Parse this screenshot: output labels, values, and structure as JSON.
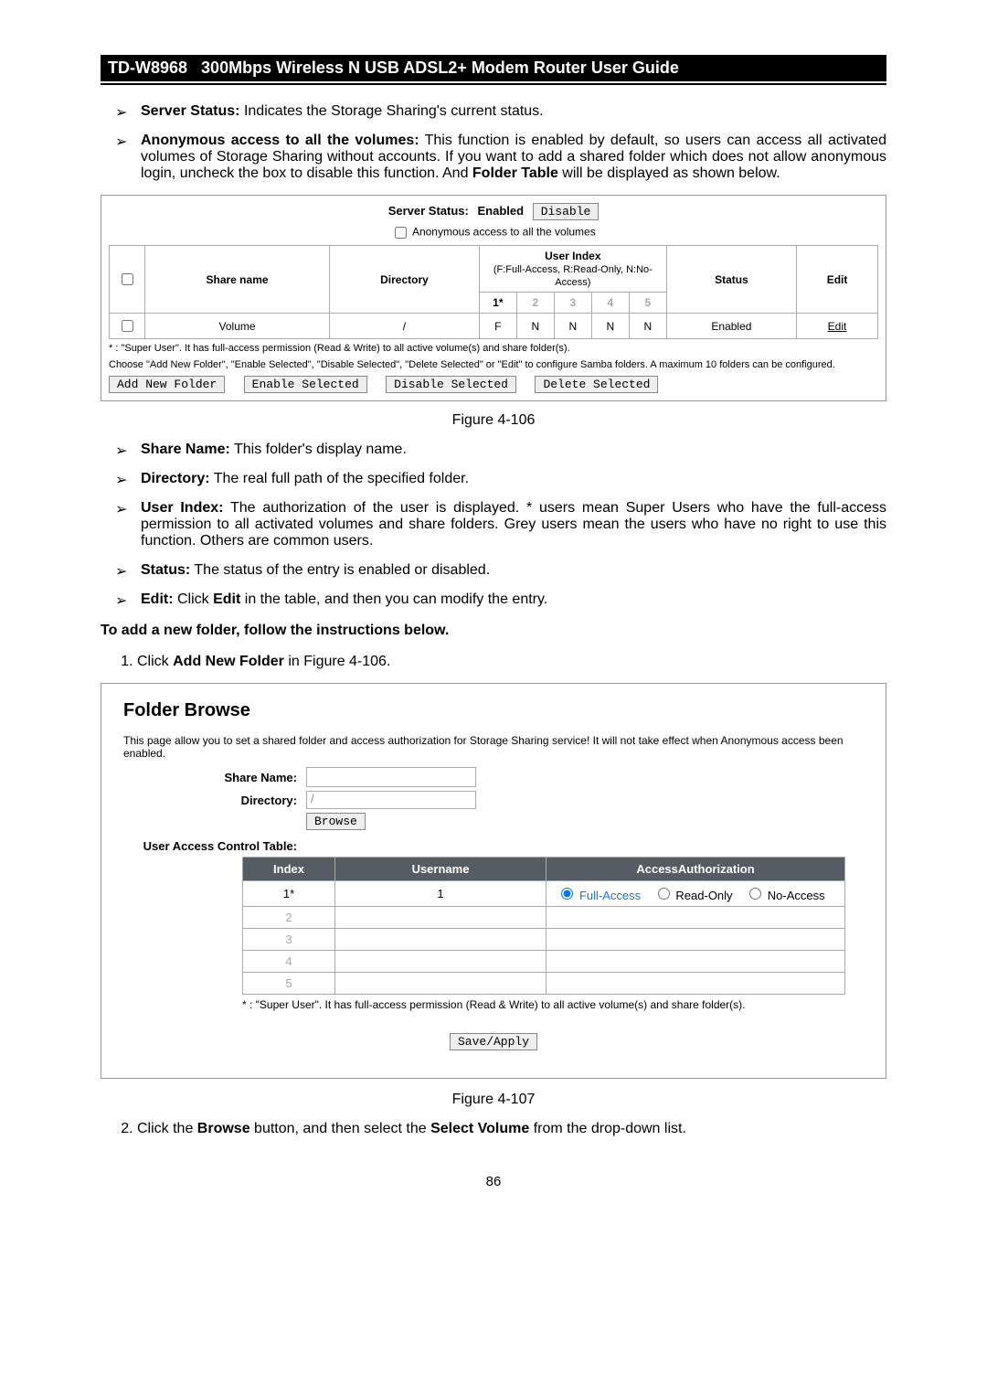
{
  "header": {
    "model": "TD-W8968",
    "title": "300Mbps Wireless N USB ADSL2+ Modem Router User Guide"
  },
  "intro_bullets": {
    "b1_label": "Server Status:",
    "b1_text": " Indicates the Storage Sharing's current status.",
    "b2_label": "Anonymous access to all the volumes:",
    "b2_text": " This function is enabled by default, so users can access all activated volumes of Storage Sharing without accounts. If you want to add a shared folder which does not allow anonymous login, uncheck the box to disable this function. And ",
    "b2_bold2": "Folder Table",
    "b2_tail": " will be displayed as shown below."
  },
  "fig106": {
    "server_status_label": "Server Status:",
    "enabled": "Enabled",
    "disable_btn": "Disable",
    "anon_label": "Anonymous access to all the volumes",
    "th_share": "Share name",
    "th_dir": "Directory",
    "th_userindex": "User Index",
    "th_userindex_sub": "(F:Full-Access, R:Read-Only, N:No-Access)",
    "th_status": "Status",
    "th_edit": "Edit",
    "row": {
      "share": "Volume",
      "dir": "/",
      "u1": "F",
      "u2": "N",
      "u3": "N",
      "u4": "N",
      "u5": "N",
      "status": "Enabled",
      "edit": "Edit"
    },
    "idx1": "1*",
    "idx2": "2",
    "idx3": "3",
    "idx4": "4",
    "idx5": "5",
    "note1": "* : \"Super User\". It has full-access permission (Read & Write) to all active volume(s) and share folder(s).",
    "note2": "Choose \"Add New Folder\", \"Enable Selected\", \"Disable Selected\", \"Delete Selected\" or \"Edit\" to configure Samba folders. A maximum 10 folders can be configured.",
    "btn_add": "Add New Folder",
    "btn_en": "Enable Selected",
    "btn_dis": "Disable Selected",
    "btn_del": "Delete Selected",
    "caption": "Figure 4-106"
  },
  "mid_bullets": {
    "b1_label": "Share Name:",
    "b1_text": " This folder's display name.",
    "b2_label": "Directory:",
    "b2_text": " The real full path of the specified folder.",
    "b3_label": "User Index:",
    "b3_text": " The authorization of the user is displayed. * users mean Super Users who have the full-access permission to all activated volumes and share folders. Grey users mean the users who have no right to use this function. Others are common users.",
    "b4_label": "Status:",
    "b4_text": " The status of the entry is enabled or disabled.",
    "b5_label": "Edit:",
    "b5_pre": " Click ",
    "b5_bold": "Edit",
    "b5_post": " in the table, and then you can modify the entry."
  },
  "add_heading": "To add a new folder, follow the instructions below.",
  "step1_pre": "Click ",
  "step1_bold": "Add New Folder",
  "step1_post": " in Figure 4-106.",
  "fig107": {
    "title": "Folder Browse",
    "desc": "This page allow you to set a shared folder and access authorization for Storage Sharing service! It will not take effect when Anonymous access been enabled.",
    "lbl_share": "Share Name:",
    "lbl_dir": "Directory:",
    "dir_val": "/",
    "btn_browse": "Browse",
    "lbl_uact": "User Access Control Table:",
    "th_index": "Index",
    "th_user": "Username",
    "th_auth": "AccessAuthorization",
    "rows": [
      {
        "idx": "1*",
        "user": "1",
        "full": "Full-Access",
        "ro": "Read-Only",
        "na": "No-Access",
        "grey": false
      },
      {
        "idx": "2",
        "user": "",
        "full": "",
        "ro": "",
        "na": "",
        "grey": true
      },
      {
        "idx": "3",
        "user": "",
        "full": "",
        "ro": "",
        "na": "",
        "grey": true
      },
      {
        "idx": "4",
        "user": "",
        "full": "",
        "ro": "",
        "na": "",
        "grey": true
      },
      {
        "idx": "5",
        "user": "",
        "full": "",
        "ro": "",
        "na": "",
        "grey": true
      }
    ],
    "sunote": "* : \"Super User\". It has full-access permission (Read & Write) to all active volume(s) and share folder(s).",
    "apply": "Save/Apply",
    "caption": "Figure 4-107"
  },
  "step2_pre": "Click the ",
  "step2_b1": "Browse",
  "step2_mid": " button, and then select the ",
  "step2_b2": "Select Volume",
  "step2_post": " from the drop-down list.",
  "page_number": "86"
}
